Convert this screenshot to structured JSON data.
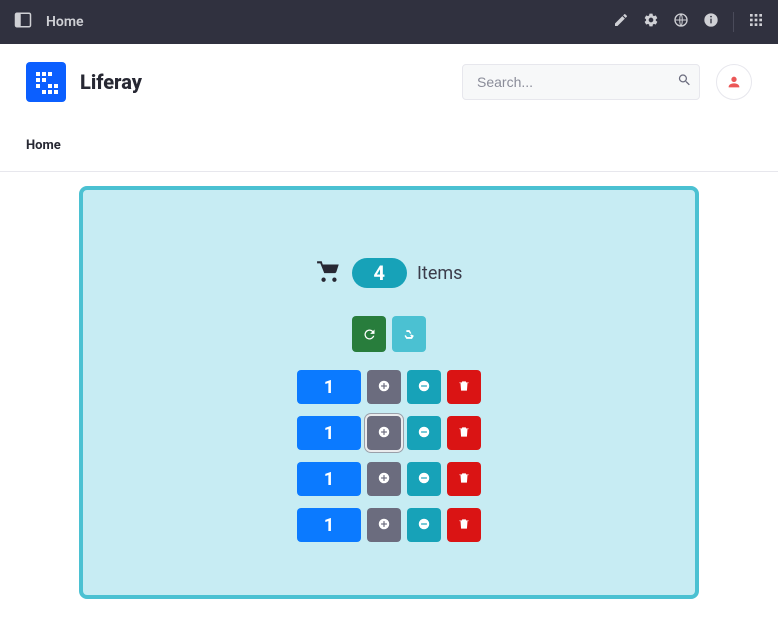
{
  "topbar": {
    "title": "Home"
  },
  "header": {
    "brand": "Liferay",
    "search_placeholder": "Search..."
  },
  "nav": {
    "home": "Home"
  },
  "cart": {
    "count": "4",
    "items_label": "Items",
    "rows": [
      {
        "qty": "1"
      },
      {
        "qty": "1"
      },
      {
        "qty": "1"
      },
      {
        "qty": "1"
      }
    ]
  },
  "colors": {
    "accent": "#0b5fff",
    "teal": "#17a2b8",
    "border": "#4bc1d2",
    "panel": "#c7ecf3",
    "danger": "#da1414",
    "success": "#287d3c"
  }
}
